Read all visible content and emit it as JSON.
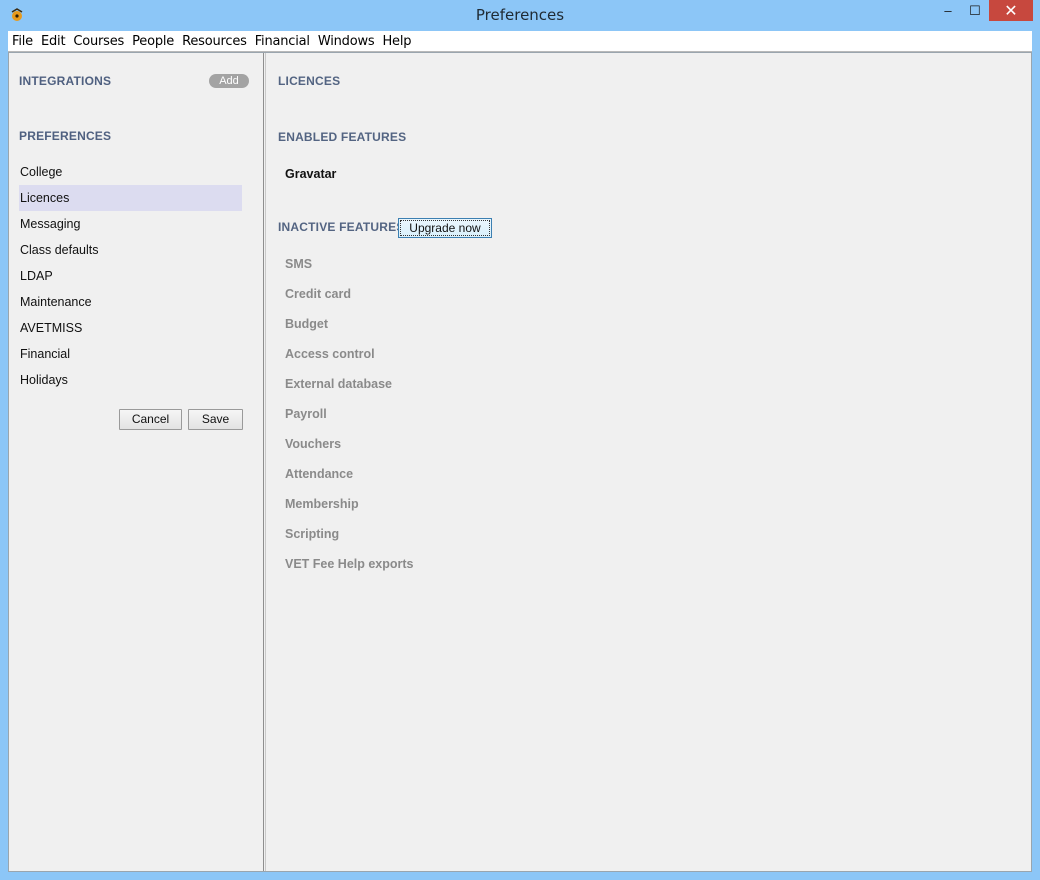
{
  "window": {
    "title": "Preferences",
    "minimize_glyph": "–",
    "maximize_glyph": "☐",
    "close_glyph": "✕"
  },
  "menubar": {
    "items": [
      "File",
      "Edit",
      "Courses",
      "People",
      "Resources",
      "Financial",
      "Windows",
      "Help"
    ]
  },
  "sidebar": {
    "integrations_heading": "INTEGRATIONS",
    "add_label": "Add",
    "preferences_heading": "PREFERENCES",
    "items": [
      {
        "label": "College"
      },
      {
        "label": "Licences",
        "selected": true
      },
      {
        "label": "Messaging"
      },
      {
        "label": "Class defaults"
      },
      {
        "label": "LDAP"
      },
      {
        "label": "Maintenance"
      },
      {
        "label": "AVETMISS"
      },
      {
        "label": "Financial"
      },
      {
        "label": "Holidays"
      }
    ],
    "cancel_label": "Cancel",
    "save_label": "Save"
  },
  "main": {
    "title": "LICENCES",
    "enabled_heading": "ENABLED FEATURES",
    "enabled": [
      "Gravatar"
    ],
    "inactive_heading": "INACTIVE FEATURES",
    "upgrade_label": "Upgrade now",
    "inactive": [
      "SMS",
      "Credit card",
      "Budget",
      "Access control",
      "External database",
      "Payroll",
      "Vouchers",
      "Attendance",
      "Membership",
      "Scripting",
      "VET Fee Help exports"
    ]
  },
  "colors": {
    "titlebar": "#8cc6f7",
    "close": "#c7483e",
    "selected": "#dcdcf0",
    "heading": "#4f6080",
    "inactive_text": "#8a8a8a"
  },
  "icons": {
    "app": "app-logo-icon"
  }
}
